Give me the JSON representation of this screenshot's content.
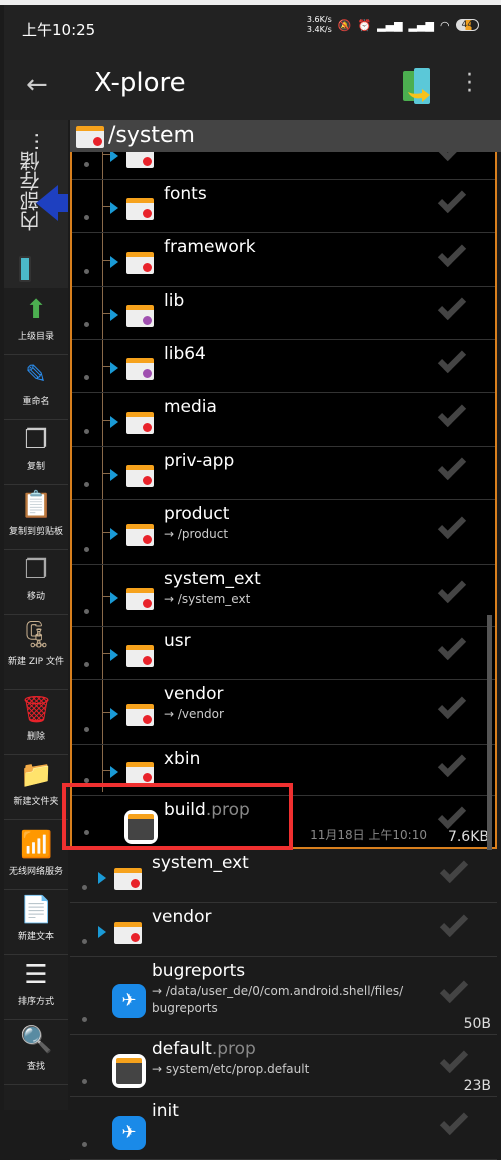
{
  "status": {
    "time": "上午10:25",
    "speed_up": "3.6K/s",
    "speed_down": "3.4K/s",
    "battery": "44"
  },
  "appbar": {
    "title": "X-plore"
  },
  "volume": {
    "label": "内部存储..."
  },
  "toolbar": [
    {
      "label": "上级目录",
      "icon": "up-arrow-icon"
    },
    {
      "label": "重命名",
      "icon": "rename-icon"
    },
    {
      "label": "复制",
      "icon": "copy-icon"
    },
    {
      "label": "复制到剪贴板",
      "icon": "clipboard-icon"
    },
    {
      "label": "移动",
      "icon": "move-icon"
    },
    {
      "label": "新建 ZIP 文件",
      "icon": "zip-icon"
    },
    {
      "label": "删除",
      "icon": "trash-icon"
    },
    {
      "label": "新建文件夹",
      "icon": "new-folder-icon"
    },
    {
      "label": "无线网络服务",
      "icon": "wifi-icon"
    },
    {
      "label": "新建文本",
      "icon": "new-text-icon"
    },
    {
      "label": "排序方式",
      "icon": "sort-icon"
    },
    {
      "label": "查找",
      "icon": "search-icon"
    }
  ],
  "path": {
    "label": "/system"
  },
  "inner_items": [
    {
      "name": "",
      "type": "folder"
    },
    {
      "name": "fonts",
      "type": "folder"
    },
    {
      "name": "framework",
      "type": "folder"
    },
    {
      "name": "lib",
      "type": "folder",
      "dot": "#a050b0"
    },
    {
      "name": "lib64",
      "type": "folder",
      "dot": "#a050b0"
    },
    {
      "name": "media",
      "type": "folder"
    },
    {
      "name": "priv-app",
      "type": "folder"
    },
    {
      "name": "product",
      "type": "folder",
      "link": "→ /product"
    },
    {
      "name": "system_ext",
      "type": "folder",
      "link": "→ /system_ext"
    },
    {
      "name": "usr",
      "type": "folder"
    },
    {
      "name": "vendor",
      "type": "folder",
      "link": "→ /vendor"
    },
    {
      "name": "xbin",
      "type": "folder"
    },
    {
      "name": "build",
      "ext": ".prop",
      "type": "file",
      "date": "11月18日 上午10:10",
      "size": "7.6KB"
    }
  ],
  "outer_items": [
    {
      "name": "system_ext",
      "type": "folder"
    },
    {
      "name": "vendor",
      "type": "folder"
    },
    {
      "name": "bugreports",
      "type": "link",
      "link": "→ /data/user_de/0/com.android.shell/files/",
      "link2": "bugreports",
      "size": "50B"
    },
    {
      "name": "default",
      "ext": ".prop",
      "type": "file",
      "link": "→ system/etc/prop.default",
      "size": "23B"
    },
    {
      "name": "init",
      "type": "link"
    }
  ],
  "colors": {
    "accent": "#d9801e",
    "highlight": "#f03030",
    "folder": "#f6a21c",
    "expand": "#1a9ad6"
  }
}
